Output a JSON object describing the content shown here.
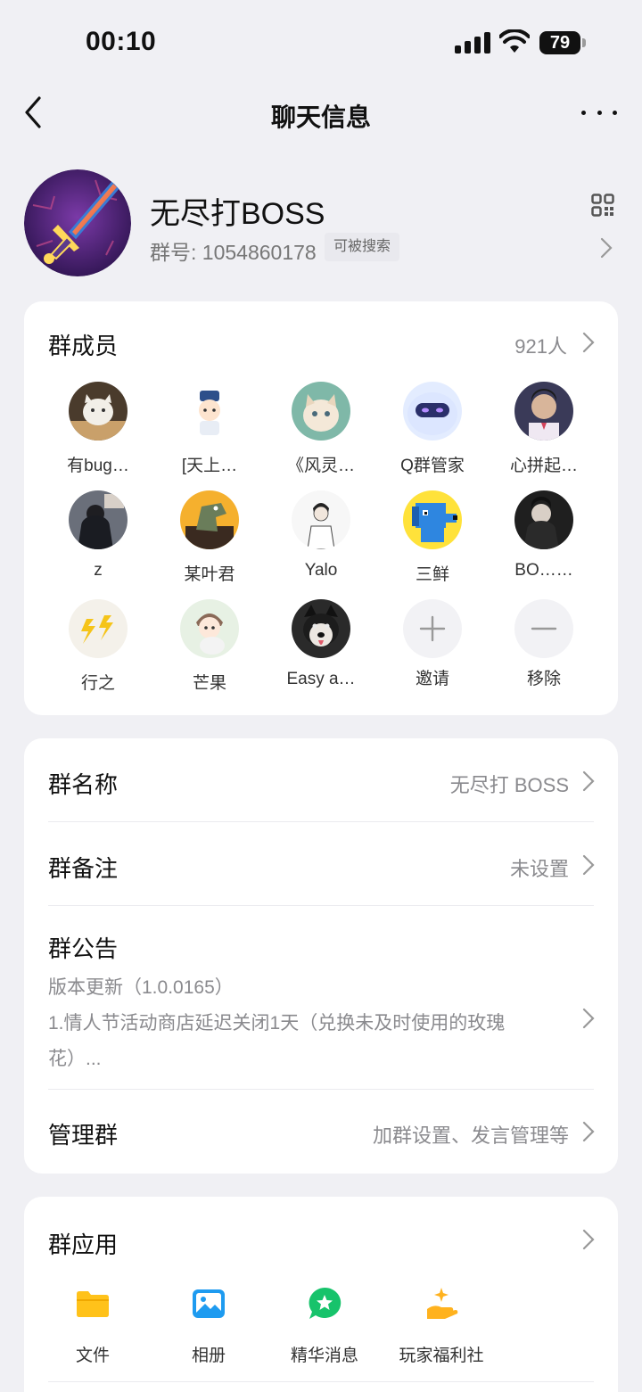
{
  "status_bar": {
    "time": "00:10",
    "battery": "79"
  },
  "nav": {
    "title": "聊天信息"
  },
  "group": {
    "name": "无尽打BOSS",
    "id_label": "群号: 1054860178",
    "search_badge": "可被搜索"
  },
  "members": {
    "title": "群成员",
    "count": "921人",
    "items": [
      {
        "name": "有bug…",
        "avatar": "cat-avatar"
      },
      {
        "name": "[天上…",
        "avatar": "cartoon-boy-avatar"
      },
      {
        "name": "《风灵…",
        "avatar": "kitten-avatar"
      },
      {
        "name": "Q群管家",
        "avatar": "robot-avatar"
      },
      {
        "name": "心拼起…",
        "avatar": "boy-photo-avatar"
      },
      {
        "name": "z",
        "avatar": "hoodie-avatar"
      },
      {
        "name": "某叶君",
        "avatar": "dinosaur-avatar"
      },
      {
        "name": "Yalo",
        "avatar": "sketch-avatar"
      },
      {
        "name": "三鲜",
        "avatar": "pixel-dog-avatar"
      },
      {
        "name": "BO……",
        "avatar": "dark-portrait-avatar"
      },
      {
        "name": "行之",
        "avatar": "lightning-avatar"
      },
      {
        "name": "芒果",
        "avatar": "anime-cat-avatar"
      },
      {
        "name": "Easy a…",
        "avatar": "husky-avatar"
      }
    ],
    "invite_label": "邀请",
    "remove_label": "移除"
  },
  "settings": {
    "group_name_label": "群名称",
    "group_name_value": "无尽打 BOSS",
    "remark_label": "群备注",
    "remark_value": "未设置",
    "notice_label": "群公告",
    "notice_line1": "版本更新（1.0.0165）",
    "notice_line2": "1.情人节活动商店延迟关闭1天（兑换未及时使用的玫瑰",
    "notice_line3": "花）...",
    "manage_label": "管理群",
    "manage_value": "加群设置、发言管理等"
  },
  "apps": {
    "title": "群应用",
    "items": [
      {
        "label": "文件",
        "icon": "folder-icon",
        "color": "#ffc21a"
      },
      {
        "label": "相册",
        "icon": "album-icon",
        "color": "#1e9bf0"
      },
      {
        "label": "精华消息",
        "icon": "star-message-icon",
        "color": "#17c36b"
      },
      {
        "label": "玩家福利社",
        "icon": "gift-hand-icon",
        "color": "#ffb21e"
      }
    ]
  }
}
